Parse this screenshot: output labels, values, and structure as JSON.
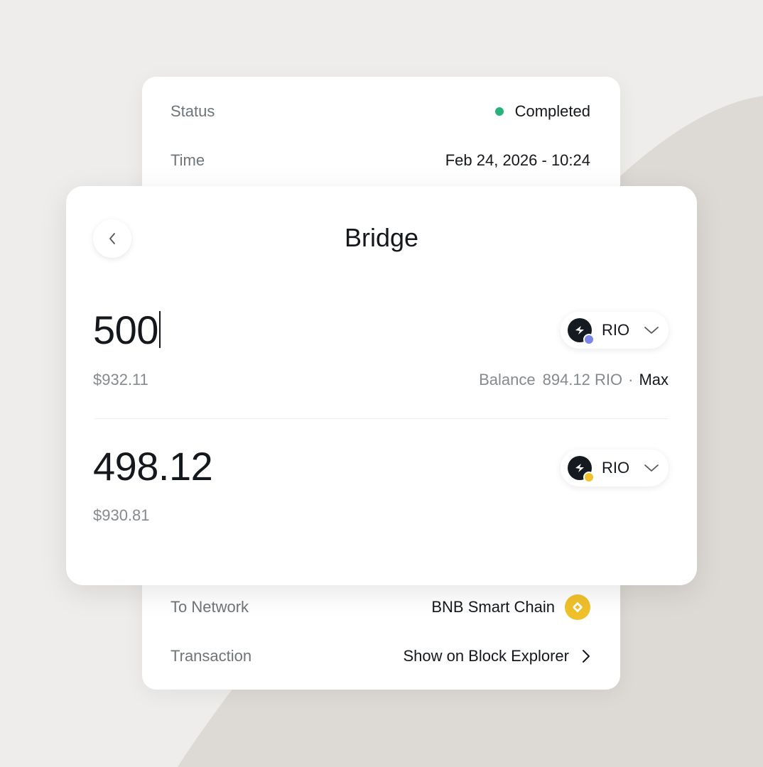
{
  "details": {
    "status_label": "Status",
    "status_value": "Completed",
    "time_label": "Time",
    "time_value": "Feb 24, 2026 - 10:24",
    "network_label": "To Network",
    "network_value": "BNB Smart Chain",
    "tx_label": "Transaction",
    "tx_value": "Show on Block Explorer"
  },
  "bridge": {
    "title": "Bridge",
    "from": {
      "amount": "500",
      "usd": "$932.11",
      "token": "RIO",
      "balance_label": "Balance",
      "balance_value": "894.12 RIO",
      "separator": "·",
      "max_label": "Max"
    },
    "to": {
      "amount": "498.12",
      "usd": "$930.81",
      "token": "RIO"
    }
  },
  "colors": {
    "status_green": "#27b27a",
    "bnb_yellow": "#f0c12b",
    "eth_badge": "#7b86e8"
  },
  "icons": [
    "back-chevron-icon",
    "chevron-down-icon",
    "chevron-right-icon",
    "bnb-icon",
    "rio-token-icon"
  ]
}
